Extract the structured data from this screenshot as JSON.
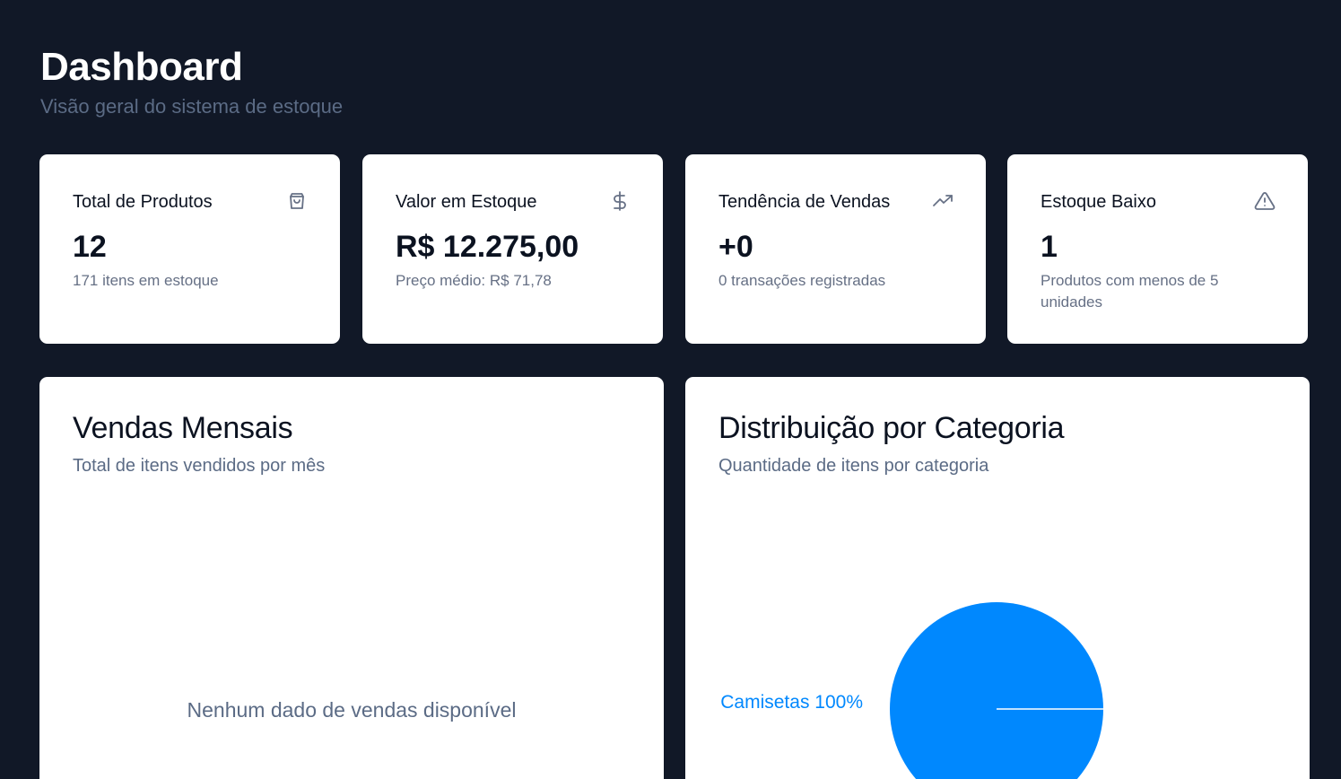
{
  "header": {
    "title": "Dashboard",
    "subtitle": "Visão geral do sistema de estoque"
  },
  "stats": [
    {
      "title": "Total de Produtos",
      "value": "12",
      "desc": "171 itens em estoque",
      "icon": "shopping-bag-icon"
    },
    {
      "title": "Valor em Estoque",
      "value": "R$ 12.275,00",
      "desc": "Preço médio: R$ 71,78",
      "icon": "dollar-icon"
    },
    {
      "title": "Tendência de Vendas",
      "value": "+0",
      "desc": "0 transações registradas",
      "icon": "trending-up-icon"
    },
    {
      "title": "Estoque Baixo",
      "value": "1",
      "desc": "Produtos com menos de 5 unidades",
      "icon": "alert-triangle-icon"
    }
  ],
  "sales_card": {
    "title": "Vendas Mensais",
    "subtitle": "Total de itens vendidos por mês",
    "empty_message": "Nenhum dado de vendas disponível"
  },
  "category_card": {
    "title": "Distribuição por Categoria",
    "subtitle": "Quantidade de itens por categoria"
  },
  "chart_data": {
    "type": "pie",
    "slices": [
      {
        "label": "Camisetas",
        "value": 100,
        "display": "Camisetas 100%",
        "color": "#0088fe"
      }
    ]
  },
  "colors": {
    "background": "#111827",
    "card": "#ffffff",
    "accent": "#0088fe",
    "muted": "#5b6b85"
  }
}
